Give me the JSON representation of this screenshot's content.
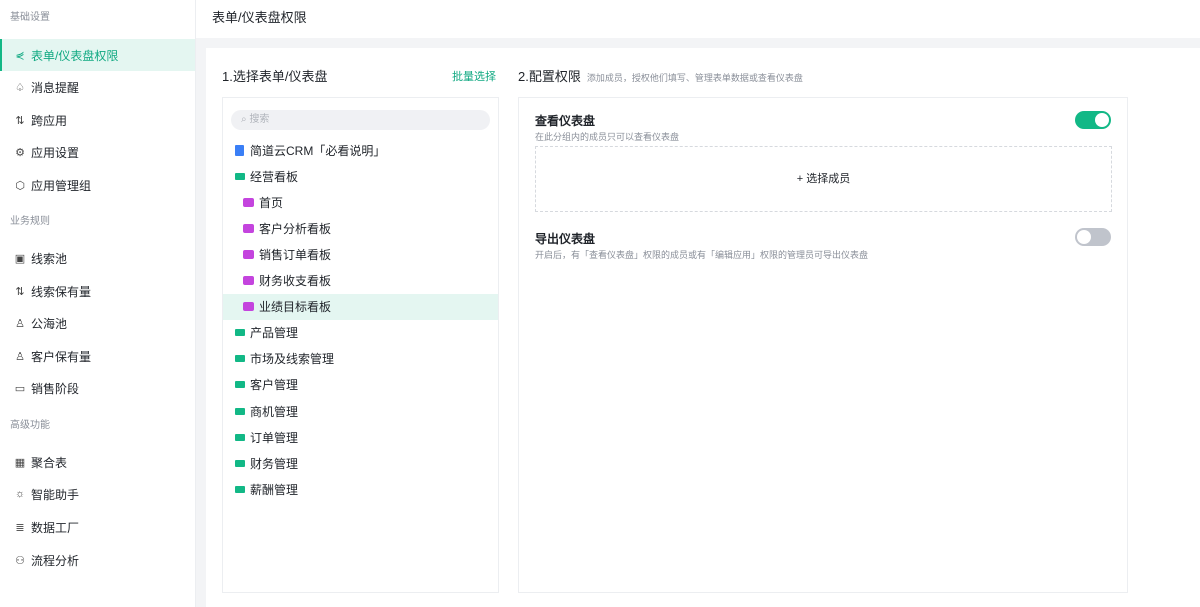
{
  "sidebar": {
    "sections": [
      {
        "title": "基础设置",
        "items": [
          {
            "label": "表单/仪表盘权限",
            "icon": "share-icon",
            "active": true
          },
          {
            "label": "消息提醒",
            "icon": "bell-icon"
          },
          {
            "label": "跨应用",
            "icon": "arrows-icon"
          },
          {
            "label": "应用设置",
            "icon": "gear-icon"
          },
          {
            "label": "应用管理组",
            "icon": "cube-icon"
          }
        ]
      },
      {
        "title": "业务规则",
        "items": [
          {
            "label": "线索池",
            "icon": "pool-icon"
          },
          {
            "label": "线索保有量",
            "icon": "arrows-icon"
          },
          {
            "label": "公海池",
            "icon": "users-icon"
          },
          {
            "label": "客户保有量",
            "icon": "users-icon"
          },
          {
            "label": "销售阶段",
            "icon": "card-icon"
          }
        ]
      },
      {
        "title": "高级功能",
        "items": [
          {
            "label": "聚合表",
            "icon": "table-icon"
          },
          {
            "label": "智能助手",
            "icon": "bulb-icon"
          },
          {
            "label": "数据工厂",
            "icon": "database-icon"
          },
          {
            "label": "流程分析",
            "icon": "flow-icon"
          }
        ]
      }
    ]
  },
  "header": {
    "title": "表单/仪表盘权限"
  },
  "left": {
    "title": "1.选择表单/仪表盘",
    "batch": "批量选择",
    "search_placeholder": "搜索",
    "tree": [
      {
        "label": "简道云CRM「必看说明」",
        "type": "doc"
      },
      {
        "label": "经营看板",
        "type": "folder"
      },
      {
        "label": "首页",
        "type": "dash"
      },
      {
        "label": "客户分析看板",
        "type": "dash"
      },
      {
        "label": "销售订单看板",
        "type": "dash"
      },
      {
        "label": "财务收支看板",
        "type": "dash"
      },
      {
        "label": "业绩目标看板",
        "type": "dash",
        "selected": true
      },
      {
        "label": "产品管理",
        "type": "folder"
      },
      {
        "label": "市场及线索管理",
        "type": "folder"
      },
      {
        "label": "客户管理",
        "type": "folder"
      },
      {
        "label": "商机管理",
        "type": "folder"
      },
      {
        "label": "订单管理",
        "type": "folder"
      },
      {
        "label": "财务管理",
        "type": "folder"
      },
      {
        "label": "薪酬管理",
        "type": "folder"
      }
    ]
  },
  "right": {
    "title": "2.配置权限",
    "subtitle": "添加成员，授权他们填写、管理表单数据或查看仪表盘",
    "view": {
      "title": "查看仪表盘",
      "desc": "在此分组内的成员只可以查看仪表盘",
      "add": "+ 选择成员",
      "enabled": true
    },
    "export": {
      "title": "导出仪表盘",
      "desc": "开启后，有「查看仪表盘」权限的成员或有「编辑应用」权限的管理员可导出仪表盘",
      "enabled": false
    }
  },
  "colors": {
    "accent": "#12b886",
    "toggle_off": "#c0c4cc"
  }
}
